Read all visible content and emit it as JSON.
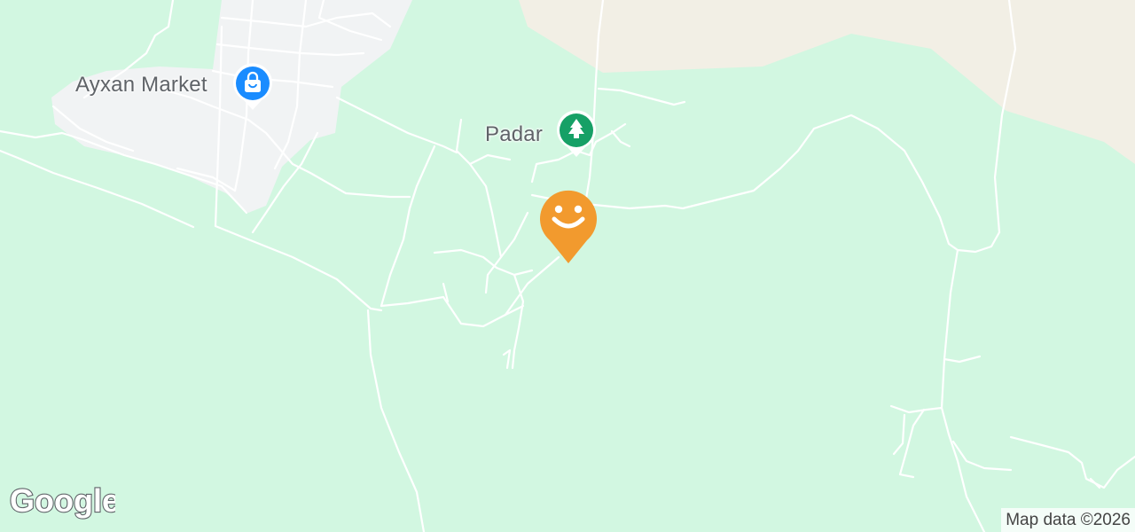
{
  "places": {
    "market": {
      "label": "Ayxan Market",
      "icon": "shopping-bag-icon",
      "color": "#1a8cff"
    },
    "padar": {
      "label": "Padar",
      "icon": "tree-icon",
      "color": "#16a066"
    }
  },
  "current_location": {
    "icon": "smiley-icon",
    "color": "#f29a2e"
  },
  "attribution": "Map data ©2026",
  "logo": "Google"
}
